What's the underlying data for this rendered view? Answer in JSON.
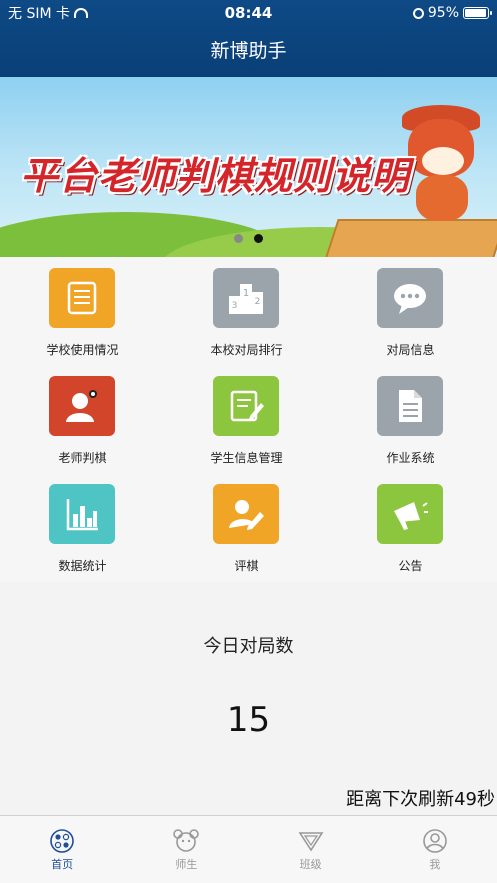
{
  "status_bar": {
    "carrier": "无 SIM 卡",
    "time": "08:44",
    "battery": "95%"
  },
  "nav": {
    "title": "新博助手"
  },
  "banner": {
    "title": "平台老师判棋规则说明",
    "page_count": 2,
    "active_page": 2
  },
  "grid": [
    {
      "label": "学校使用情况",
      "icon": "document-icon",
      "color": "#f0a526"
    },
    {
      "label": "本校对局排行",
      "icon": "podium-icon",
      "color": "#9aa4aa"
    },
    {
      "label": "对局信息",
      "icon": "chat-bubble-icon",
      "color": "#9aa4aa"
    },
    {
      "label": "老师判棋",
      "icon": "teacher-icon",
      "color": "#d2452b"
    },
    {
      "label": "学生信息管理",
      "icon": "edit-document-icon",
      "color": "#8cc63f"
    },
    {
      "label": "作业系统",
      "icon": "file-icon",
      "color": "#9aa4aa"
    },
    {
      "label": "数据统计",
      "icon": "bar-chart-icon",
      "color": "#4fc4c4"
    },
    {
      "label": "评棋",
      "icon": "user-edit-icon",
      "color": "#f0a526"
    },
    {
      "label": "公告",
      "icon": "megaphone-icon",
      "color": "#8cc63f"
    }
  ],
  "stats": {
    "title": "今日对局数",
    "count": "15",
    "refresh_text": "距离下次刷新49秒"
  },
  "tabbar": [
    {
      "label": "首页",
      "icon": "go-board-icon",
      "active": true
    },
    {
      "label": "师生",
      "icon": "teacher-student-icon",
      "active": false
    },
    {
      "label": "班级",
      "icon": "triangle-down-icon",
      "active": false
    },
    {
      "label": "我",
      "icon": "profile-icon",
      "active": false
    }
  ]
}
